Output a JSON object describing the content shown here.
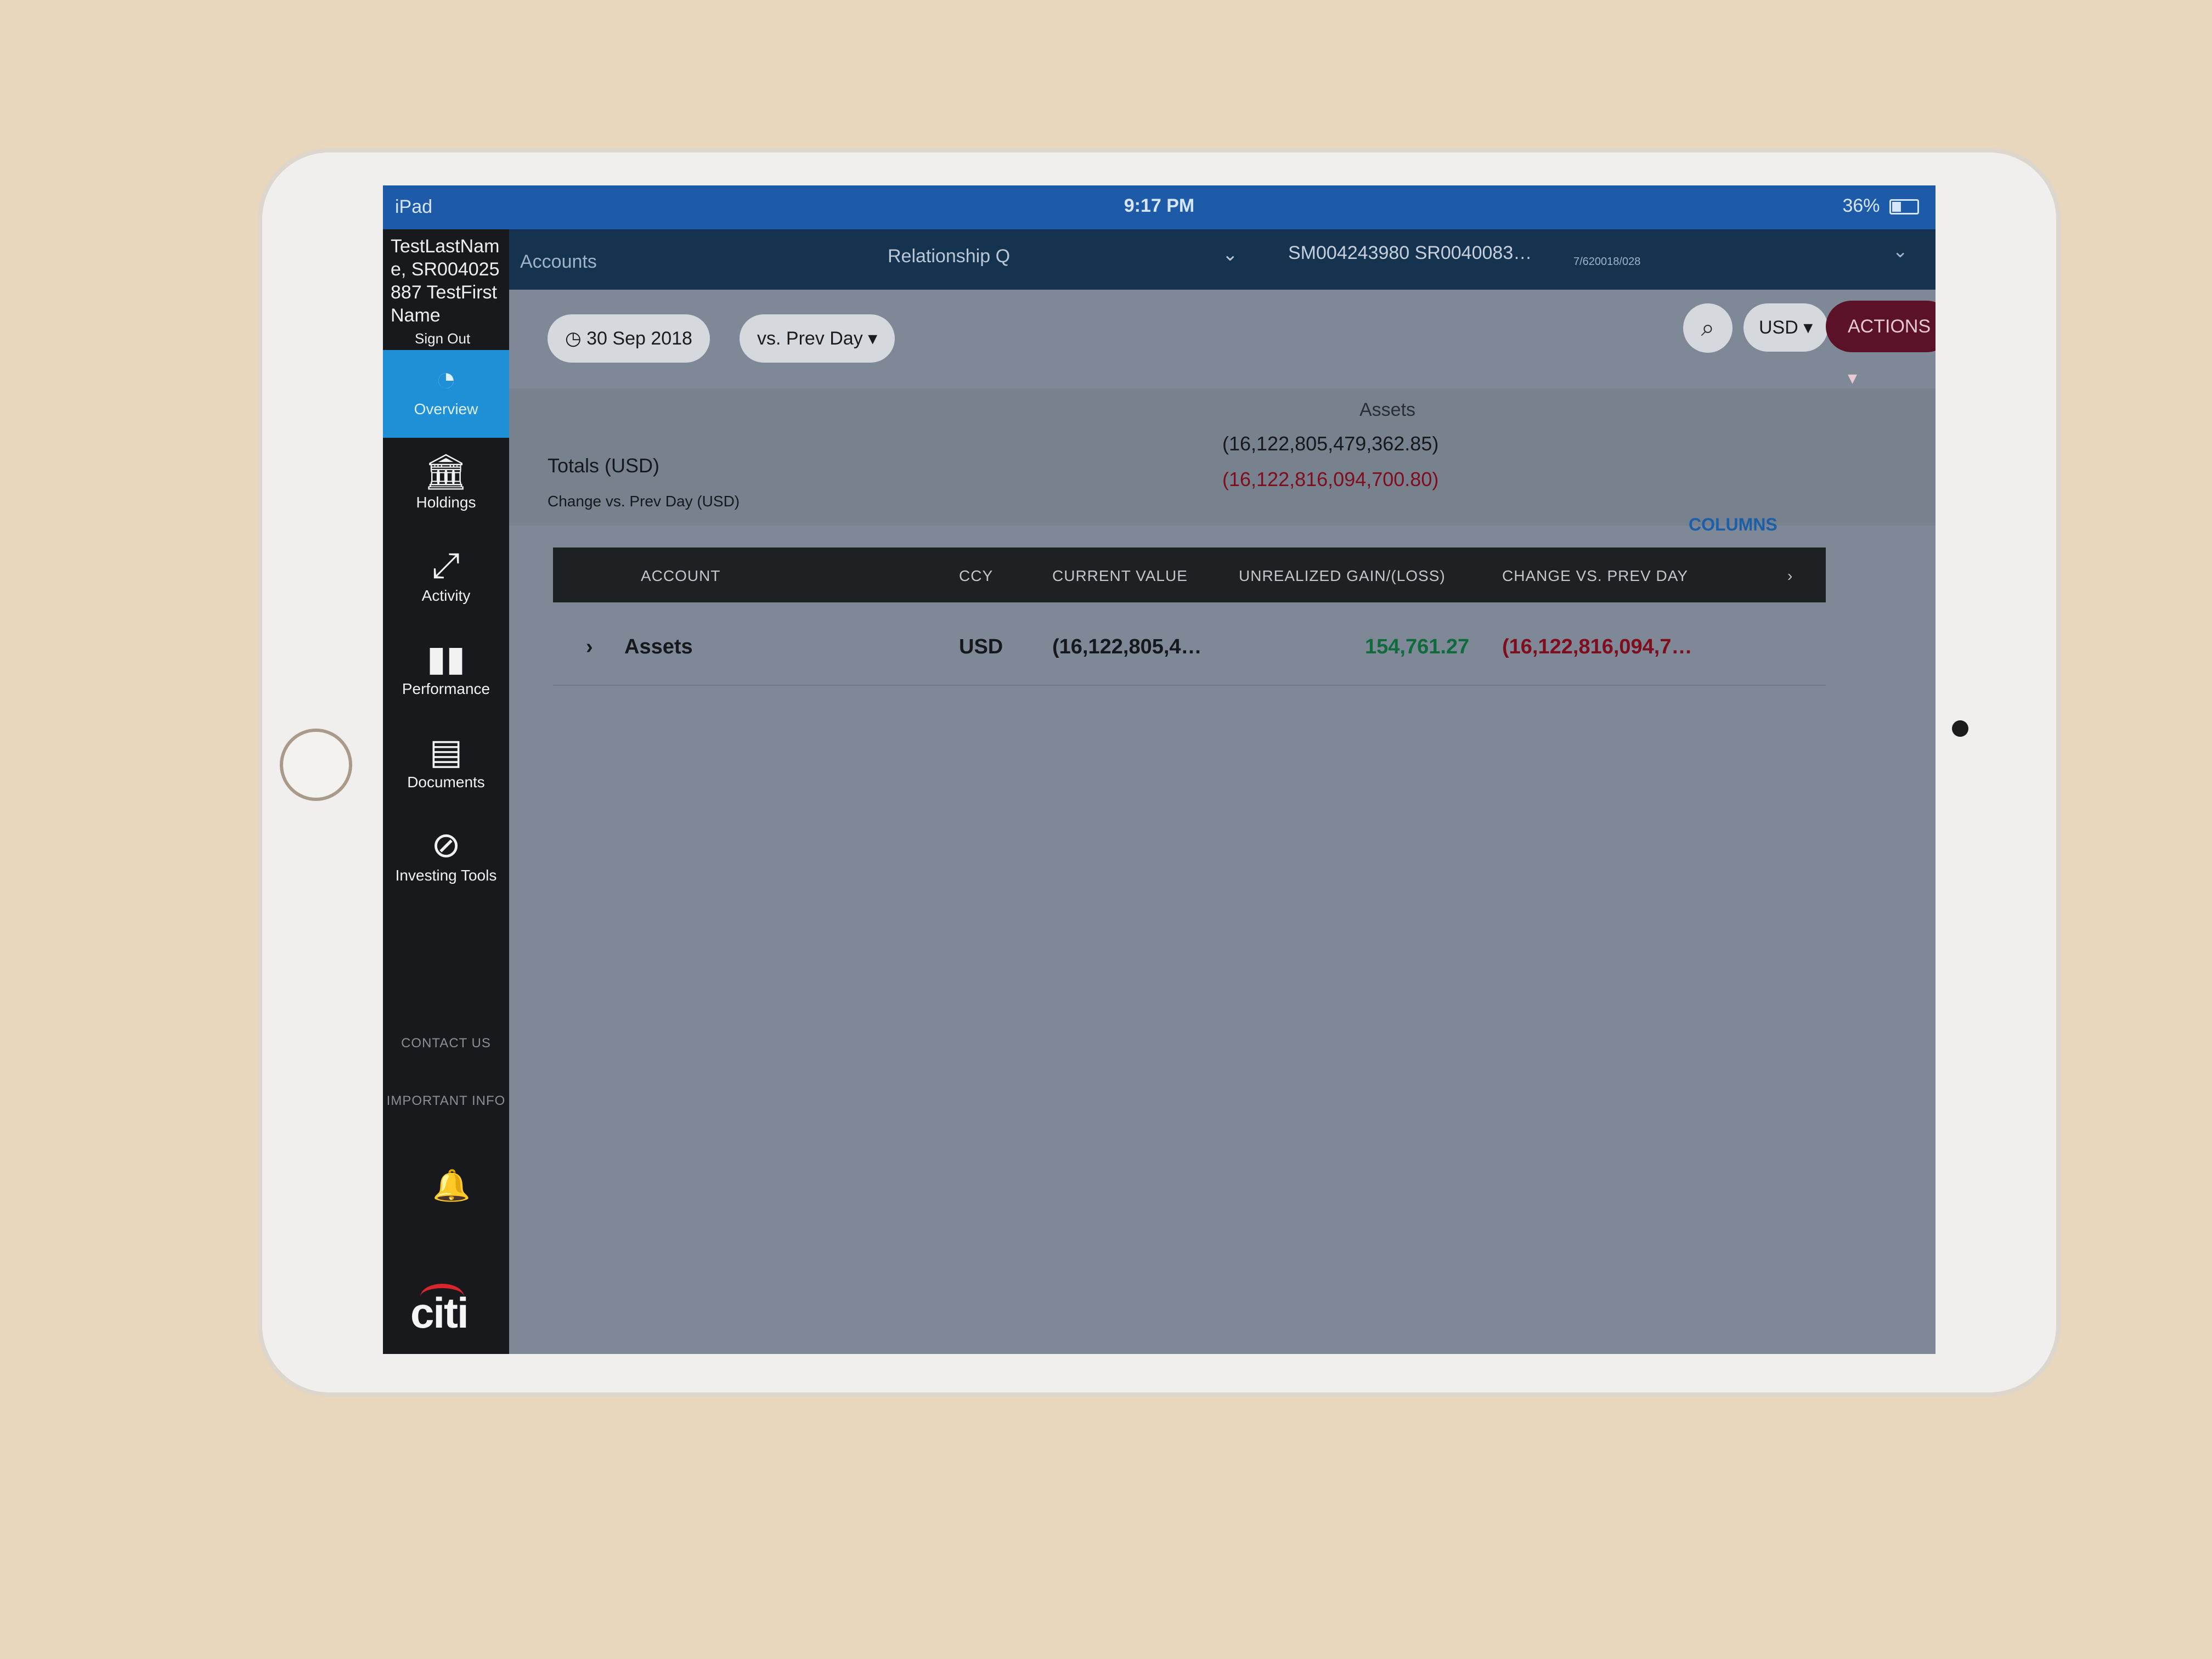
{
  "status_bar": {
    "device": "iPad",
    "time": "9:17 PM",
    "battery": "36%"
  },
  "sidebar": {
    "user_text": "TestLastName, SR004025887 TestFirstName",
    "sign_out": "Sign Out",
    "items": [
      {
        "label": "Overview",
        "icon": "speedometer-icon"
      },
      {
        "label": "Holdings",
        "icon": "bank-icon"
      },
      {
        "label": "Activity",
        "icon": "arrows-icon"
      },
      {
        "label": "Performance",
        "icon": "bar-chart-icon"
      },
      {
        "label": "Documents",
        "icon": "document-lock-icon"
      },
      {
        "label": "Investing Tools",
        "icon": "compass-icon"
      }
    ],
    "contact_us": "CONTACT US",
    "important_info": "IMPORTANT INFO",
    "logo": "citi"
  },
  "topbar": {
    "accounts": "Accounts",
    "relationship": "Relationship Q",
    "account_ids": "SM004243980 SR0040083…",
    "small_id": "7/620018/028"
  },
  "toolbar": {
    "date": "30 Sep 2018",
    "compare": "vs. Prev Day",
    "currency": "USD",
    "actions": "ACTIONS"
  },
  "totals": {
    "assets_label": "Assets",
    "totals_label": "Totals  (USD)",
    "change_label": "Change vs. Prev Day (USD)",
    "assets_total": "(16,122,805,479,362.85)",
    "assets_change": "(16,122,816,094,700.80)"
  },
  "columns_link": "COLUMNS",
  "table": {
    "headers": [
      "ACCOUNT",
      "CCY",
      "CURRENT VALUE",
      "UNREALIZED GAIN/(LOSS)",
      "CHANGE VS. PREV DAY"
    ],
    "rows": [
      {
        "account": "Assets",
        "ccy": "USD",
        "current_value": "(16,122,805,4…",
        "unrealized": "154,761.27",
        "change": "(16,122,816,094,7…"
      }
    ]
  },
  "colors": {
    "accent": "#1f8fd6",
    "actions": "#5b1228",
    "gain": "#0f6b3b",
    "loss": "#7f0d1d"
  }
}
